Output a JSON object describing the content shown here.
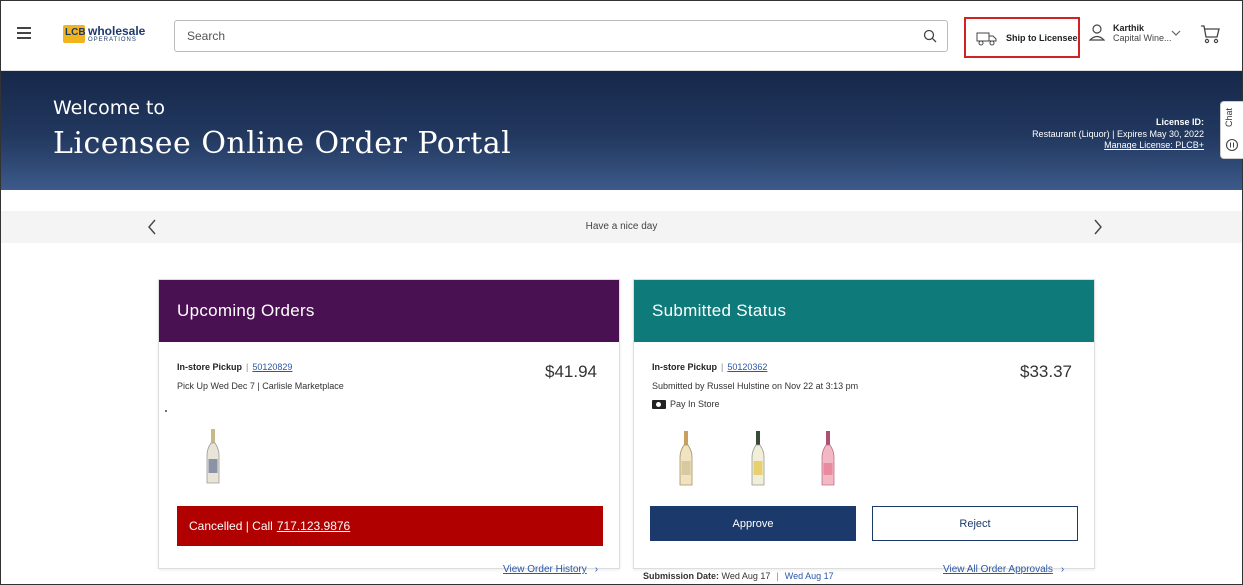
{
  "header": {
    "logo": {
      "mark": "LCB",
      "name": "wholesale",
      "sub": "OPERATIONS"
    },
    "search": {
      "placeholder": "Search"
    },
    "ship_to": {
      "label": "Ship to Licensee"
    },
    "user": {
      "name": "Karthik",
      "company": "Capital Wine..."
    }
  },
  "banner": {
    "welcome": "Welcome to",
    "title": "Licensee Online Order Portal",
    "license_id_label": "License ID:",
    "license_detail": "Restaurant (Liquor) | Expires May 30, 2022",
    "manage_link": "Manage License: PLCB+"
  },
  "chat": {
    "label": "Chat"
  },
  "carousel": {
    "message": "Have a nice day"
  },
  "upcoming": {
    "title": "Upcoming Orders",
    "type": "In-store Pickup",
    "order_number": "50120829",
    "detail": "Pick Up Wed Dec 7  | Carlisle Marketplace",
    "price": "$41.94",
    "status_text": "Cancelled | Call",
    "status_phone": "717.123.9876",
    "history_link": "View Order History"
  },
  "submitted": {
    "title": "Submitted Status",
    "type": "In-store Pickup",
    "order_number": "50120362",
    "detail": "Submitted by Russel Hulstine on Nov 22 at 3:13 pm",
    "payment": "Pay In Store",
    "price": "$33.37",
    "approve_label": "Approve",
    "reject_label": "Reject",
    "submission_label": "Submission Date:",
    "submission_date": "Wed Aug 17",
    "submission_date_2": "Wed Aug 17",
    "approvals_link": "View All Order Approvals"
  },
  "colors": {
    "upcoming_header": "#4a1152",
    "submitted_header": "#0e7a7a",
    "cancelled": "#b00000",
    "primary_button": "#1b3a6b",
    "highlight_border": "#d32020"
  }
}
